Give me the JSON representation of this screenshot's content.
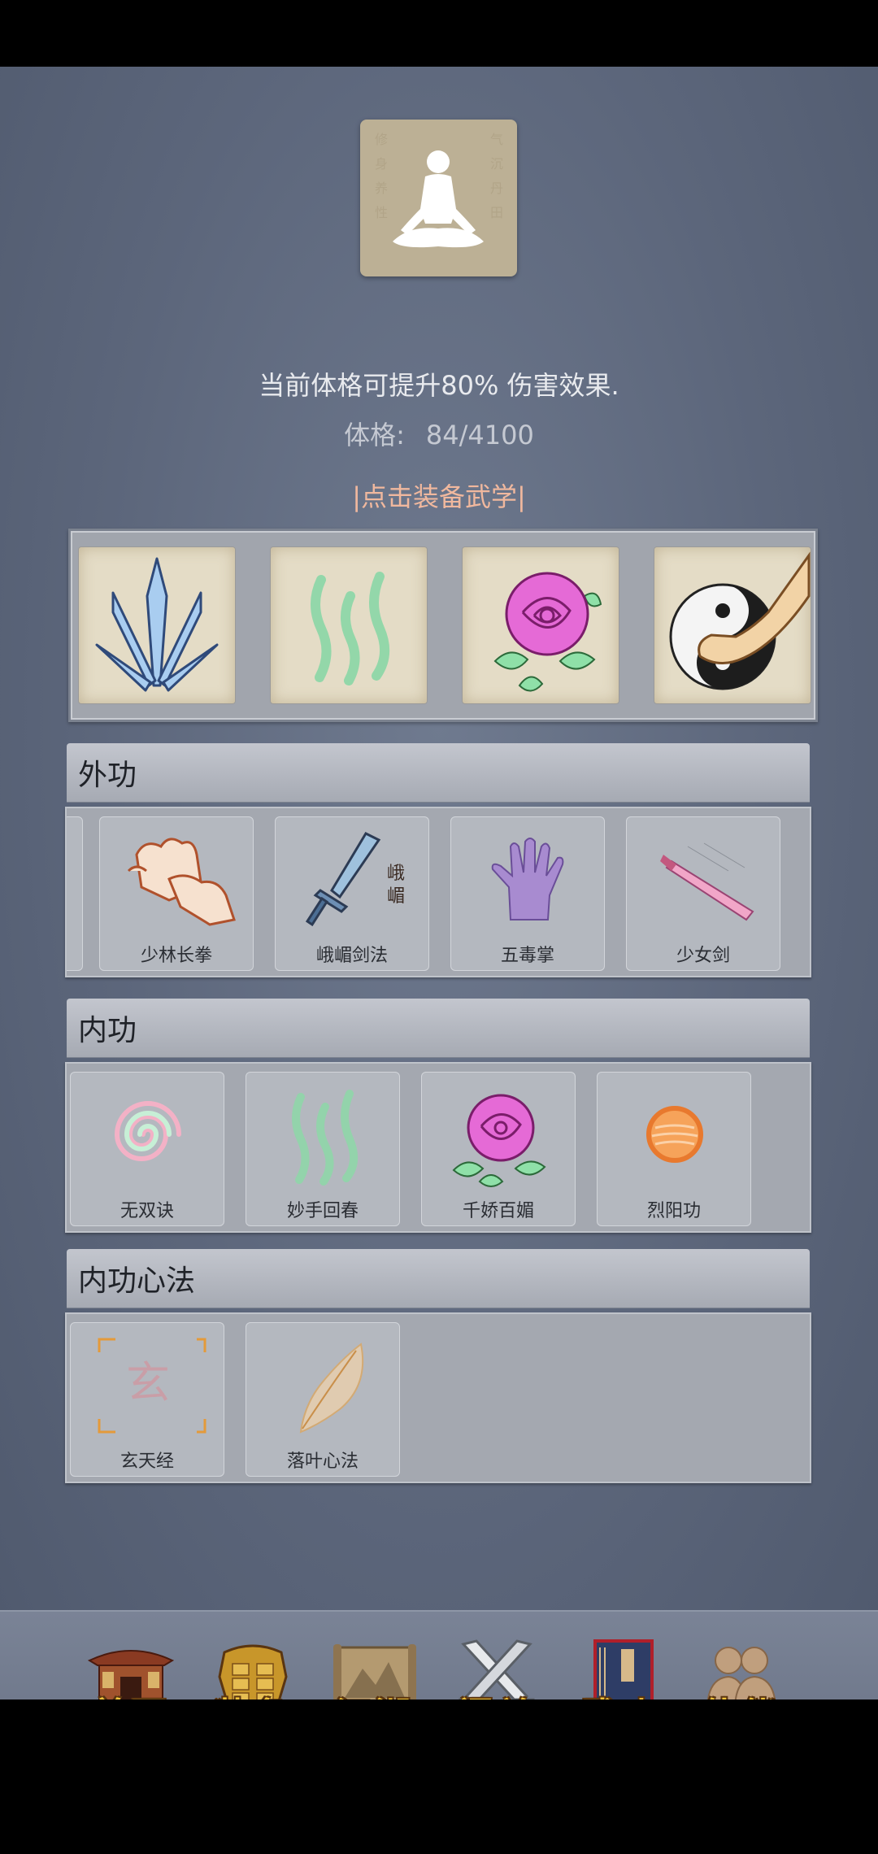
{
  "header": {
    "description": "当前体格可提升80% 伤害效果.",
    "stat_label": "体格:",
    "stat_value": "84/4100",
    "equip_link": "|点击装备武学|"
  },
  "equipped_slots": [
    {
      "icon": "crystal-blades-icon"
    },
    {
      "icon": "green-waves-icon"
    },
    {
      "icon": "rose-icon"
    },
    {
      "icon": "yin-yang-fist-icon"
    }
  ],
  "sections": {
    "waigong": {
      "title": "外功",
      "items": [
        {
          "name": "少林长拳",
          "icon": "fist-icon"
        },
        {
          "name": "峨嵋剑法",
          "icon": "sword-icon",
          "icon_text": "峨\n嵋"
        },
        {
          "name": "五毒掌",
          "icon": "purple-palm-icon"
        },
        {
          "name": "少女剑",
          "icon": "pink-blade-icon"
        }
      ]
    },
    "neigong": {
      "title": "内功",
      "items": [
        {
          "name": "无双诀",
          "icon": "spiral-icon"
        },
        {
          "name": "妙手回春",
          "icon": "green-waves-icon"
        },
        {
          "name": "千娇百媚",
          "icon": "rose-icon"
        },
        {
          "name": "烈阳功",
          "icon": "sun-icon"
        }
      ]
    },
    "xinfa": {
      "title": "内功心法",
      "items": [
        {
          "name": "玄天经",
          "icon": "xuan-scroll-icon",
          "icon_text": "玄"
        },
        {
          "name": "落叶心法",
          "icon": "leaf-icon"
        }
      ]
    }
  },
  "nav": [
    {
      "label": "首页",
      "icon": "temple-icon"
    },
    {
      "label": "装备",
      "icon": "armor-icon"
    },
    {
      "label": "江湖",
      "icon": "map-scroll-icon"
    },
    {
      "label": "闯关",
      "icon": "crossed-swords-icon"
    },
    {
      "label": "武功",
      "icon": "book-icon"
    },
    {
      "label": "伙伴",
      "icon": "companions-icon"
    }
  ],
  "colors": {
    "background": "#5c667b",
    "link": "#f0b89e",
    "nav_label": "#f2c23a"
  }
}
